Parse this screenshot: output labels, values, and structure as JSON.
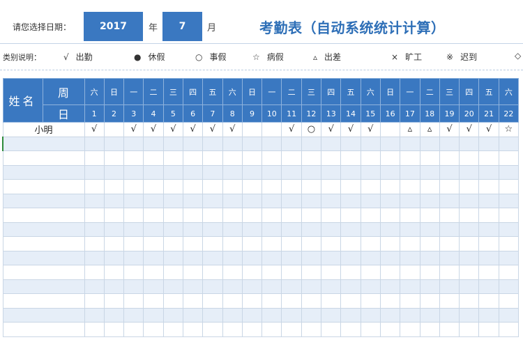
{
  "header": {
    "date_label": "请您选择日期：",
    "year": "2017",
    "year_unit": "年",
    "month": "7",
    "month_unit": "月",
    "title": "考勤表（自动系统统计计算）"
  },
  "legend": {
    "label": "类别说明：",
    "items": [
      {
        "symbol": "√",
        "text": "出勤"
      },
      {
        "symbol": "●",
        "text": "休假"
      },
      {
        "symbol": "○",
        "text": "事假"
      },
      {
        "symbol": "☆",
        "text": "病假"
      },
      {
        "symbol": "▵",
        "text": "出差"
      },
      {
        "symbol": "×",
        "text": "旷工"
      },
      {
        "symbol": "※",
        "text": "迟到"
      },
      {
        "symbol": "◇",
        "text": ""
      }
    ]
  },
  "grid": {
    "name_header": "姓名",
    "week_header": "周",
    "date_header": "日",
    "weekdays": [
      "六",
      "日",
      "一",
      "二",
      "三",
      "四",
      "五",
      "六",
      "日",
      "一",
      "二",
      "三",
      "四",
      "五",
      "六",
      "日",
      "一",
      "二",
      "三",
      "四",
      "五",
      "六"
    ],
    "dates": [
      "1",
      "2",
      "3",
      "4",
      "5",
      "6",
      "7",
      "8",
      "9",
      "10",
      "11",
      "12",
      "13",
      "14",
      "15",
      "16",
      "17",
      "18",
      "19",
      "20",
      "21",
      "22"
    ],
    "rows": [
      {
        "name": "小明",
        "marks": [
          "√",
          "",
          "√",
          "√",
          "√",
          "√",
          "√",
          "√",
          "",
          "",
          "√",
          "○",
          "√",
          "√",
          "√",
          "",
          "▵",
          "▵",
          "√",
          "√",
          "√",
          "☆"
        ]
      },
      {
        "name": "",
        "marks": []
      },
      {
        "name": "",
        "marks": []
      },
      {
        "name": "",
        "marks": []
      },
      {
        "name": "",
        "marks": []
      },
      {
        "name": "",
        "marks": []
      },
      {
        "name": "",
        "marks": []
      },
      {
        "name": "",
        "marks": []
      },
      {
        "name": "",
        "marks": []
      },
      {
        "name": "",
        "marks": []
      },
      {
        "name": "",
        "marks": []
      },
      {
        "name": "",
        "marks": []
      },
      {
        "name": "",
        "marks": []
      },
      {
        "name": "",
        "marks": []
      },
      {
        "name": "",
        "marks": []
      }
    ]
  },
  "colors": {
    "accent": "#3a78c1",
    "title": "#2e6fb7",
    "alt_row": "#e6eef8"
  }
}
